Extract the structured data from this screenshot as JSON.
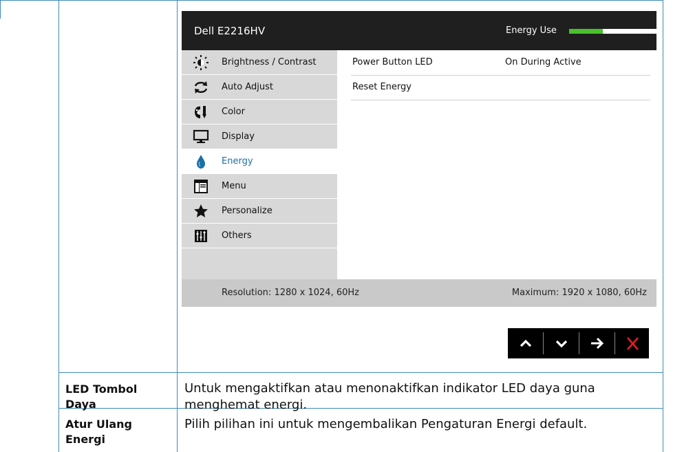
{
  "osd": {
    "title": "Dell E2216HV",
    "energy_use_label": "Energy Use",
    "energy_use_level": 0.38,
    "menu": [
      {
        "label": "Brightness / Contrast",
        "icon": "sun-icon",
        "active": false
      },
      {
        "label": "Auto Adjust",
        "icon": "auto-adjust-icon",
        "active": false
      },
      {
        "label": "Color",
        "icon": "color-palette-icon",
        "active": false
      },
      {
        "label": "Display",
        "icon": "monitor-icon",
        "active": false
      },
      {
        "label": "Energy",
        "icon": "energy-drop-icon",
        "active": true
      },
      {
        "label": "Menu",
        "icon": "menu-window-icon",
        "active": false
      },
      {
        "label": "Personalize",
        "icon": "star-icon",
        "active": false
      },
      {
        "label": "Others",
        "icon": "sliders-icon",
        "active": false
      }
    ],
    "settings": [
      {
        "name": "Power Button LED",
        "value": "On During Active"
      },
      {
        "name": "Reset Energy",
        "value": ""
      }
    ],
    "footer": {
      "resolution": "Resolution: 1280 x 1024, 60Hz",
      "maximum": "Maximum: 1920 x 1080, 60Hz"
    },
    "buttons": [
      {
        "icon": "chevron-up-icon"
      },
      {
        "icon": "chevron-down-icon"
      },
      {
        "icon": "arrow-right-icon"
      },
      {
        "icon": "close-icon"
      }
    ],
    "colors": {
      "accent": "#1b6fa8",
      "meter": "#49c02c",
      "close": "#e02020",
      "table_border": "#3f89b9"
    }
  },
  "descriptions": [
    {
      "term": "LED Tombol Daya",
      "text": "Untuk mengaktifkan atau menonaktifkan indikator LED daya guna menghemat energi."
    },
    {
      "term": "Atur Ulang Energi",
      "text": "Pilih pilihan ini untuk mengembalikan Pengaturan Energi default."
    }
  ]
}
